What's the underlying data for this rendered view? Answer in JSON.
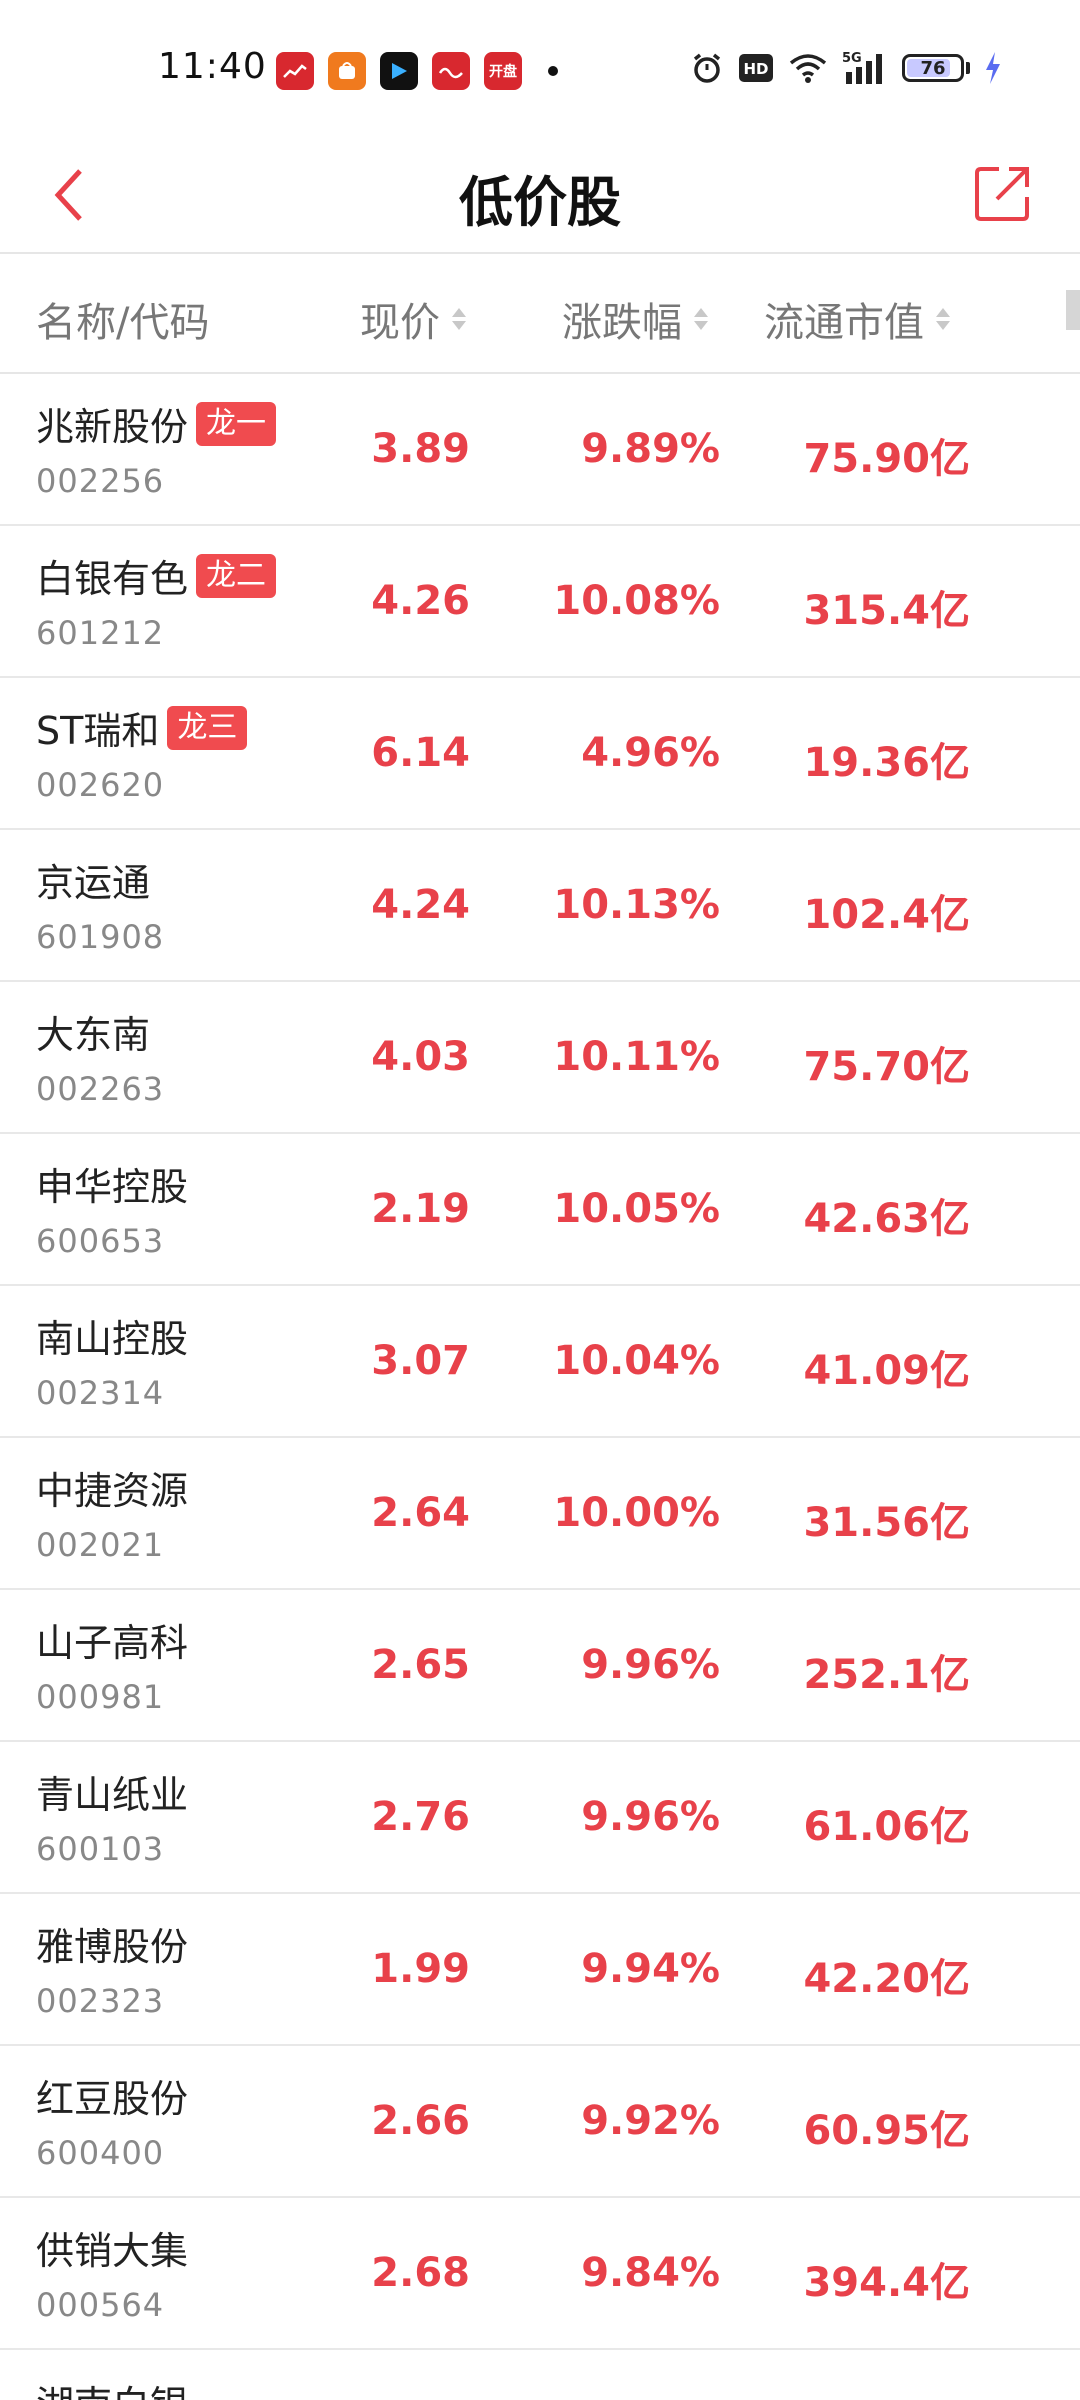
{
  "status_bar": {
    "time": "11:40",
    "battery": "76",
    "hd_label": "HD",
    "network_label": "5G",
    "notif_icons": [
      {
        "name": "stock-app-icon",
        "color": "#d8282f",
        "label": ""
      },
      {
        "name": "shopping-app-icon",
        "color": "#f07a1e",
        "label": ""
      },
      {
        "name": "play-app-icon",
        "color": "#111111",
        "label": ""
      },
      {
        "name": "broker-app-icon",
        "color": "#d8282f",
        "label": ""
      },
      {
        "name": "kaipan-app-icon",
        "color": "#d8282f",
        "label": "开盘"
      }
    ]
  },
  "header": {
    "title": "低价股"
  },
  "columns": {
    "name": "名称/代码",
    "price": "现价",
    "change": "涨跌幅",
    "cap": "流通市值"
  },
  "stocks": [
    {
      "name": "兆新股份",
      "code": "002256",
      "badge": "龙一",
      "price": "3.89",
      "change": "9.89%",
      "cap": "75.90亿"
    },
    {
      "name": "白银有色",
      "code": "601212",
      "badge": "龙二",
      "price": "4.26",
      "change": "10.08%",
      "cap": "315.4亿"
    },
    {
      "name": "ST瑞和",
      "code": "002620",
      "badge": "龙三",
      "price": "6.14",
      "change": "4.96%",
      "cap": "19.36亿"
    },
    {
      "name": "京运通",
      "code": "601908",
      "badge": "",
      "price": "4.24",
      "change": "10.13%",
      "cap": "102.4亿"
    },
    {
      "name": "大东南",
      "code": "002263",
      "badge": "",
      "price": "4.03",
      "change": "10.11%",
      "cap": "75.70亿"
    },
    {
      "name": "申华控股",
      "code": "600653",
      "badge": "",
      "price": "2.19",
      "change": "10.05%",
      "cap": "42.63亿"
    },
    {
      "name": "南山控股",
      "code": "002314",
      "badge": "",
      "price": "3.07",
      "change": "10.04%",
      "cap": "41.09亿"
    },
    {
      "name": "中捷资源",
      "code": "002021",
      "badge": "",
      "price": "2.64",
      "change": "10.00%",
      "cap": "31.56亿"
    },
    {
      "name": "山子高科",
      "code": "000981",
      "badge": "",
      "price": "2.65",
      "change": "9.96%",
      "cap": "252.1亿"
    },
    {
      "name": "青山纸业",
      "code": "600103",
      "badge": "",
      "price": "2.76",
      "change": "9.96%",
      "cap": "61.06亿"
    },
    {
      "name": "雅博股份",
      "code": "002323",
      "badge": "",
      "price": "1.99",
      "change": "9.94%",
      "cap": "42.20亿"
    },
    {
      "name": "红豆股份",
      "code": "600400",
      "badge": "",
      "price": "2.66",
      "change": "9.92%",
      "cap": "60.95亿"
    },
    {
      "name": "供销大集",
      "code": "000564",
      "badge": "",
      "price": "2.68",
      "change": "9.84%",
      "cap": "394.4亿"
    }
  ],
  "partial_row": {
    "name": "湖南白银"
  },
  "colors": {
    "up_red": "#e8414a",
    "badge_red": "#f04b4f",
    "header_icon_red": "#e8414a"
  }
}
